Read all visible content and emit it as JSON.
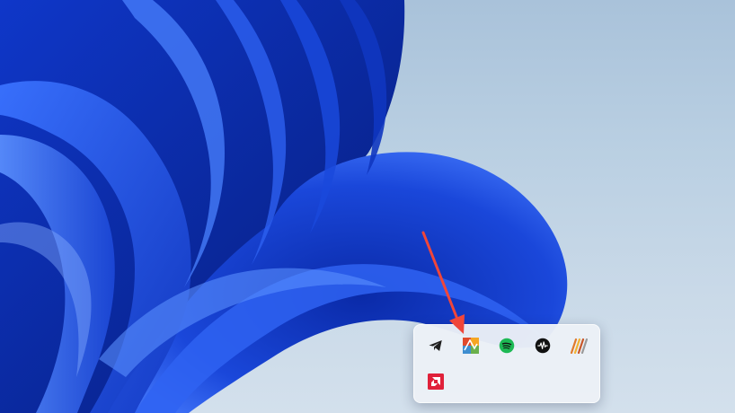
{
  "wallpaper": {
    "name": "windows-11-bloom",
    "colors": {
      "sky_top": "#a9c2da",
      "sky_bottom": "#d3e0ec",
      "bloom_dark": "#0a2a9c",
      "bloom_mid": "#1d4fe0",
      "bloom_light": "#4f86ff"
    }
  },
  "tray_overflow": {
    "icons": [
      {
        "id": "telegram",
        "name": "telegram-icon",
        "color": "#1f1f1f"
      },
      {
        "id": "avg",
        "name": "avg-antivirus-icon",
        "color": "#e0492b"
      },
      {
        "id": "spotify",
        "name": "spotify-icon",
        "color": "#1db954"
      },
      {
        "id": "audio",
        "name": "audio-waveform-icon",
        "color": "#111111"
      },
      {
        "id": "pencil",
        "name": "stylus-pens-icon",
        "color": "#e07a2c"
      },
      {
        "id": "amd",
        "name": "amd-software-icon",
        "color": "#e0213a"
      }
    ]
  },
  "annotation": {
    "arrow_color": "#f0463a",
    "points_to": "avg"
  }
}
